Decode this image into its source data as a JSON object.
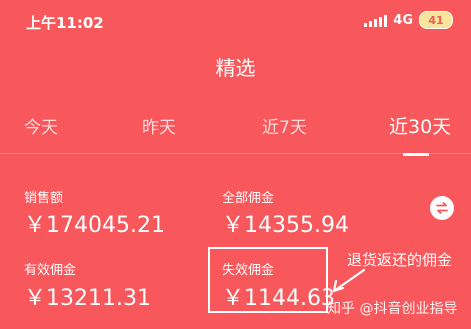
{
  "status_bar": {
    "time": "上午11:02",
    "network": "4G",
    "battery": "41"
  },
  "header": {
    "title": "精选"
  },
  "tabs": [
    {
      "label": "今天"
    },
    {
      "label": "昨天"
    },
    {
      "label": "近7天"
    },
    {
      "label": "近30天"
    }
  ],
  "active_tab": "近30天",
  "metrics": {
    "sales": {
      "label": "销售额",
      "value": "￥174045.21"
    },
    "total_commission": {
      "label": "全部佣金",
      "value": "￥14355.94"
    },
    "valid_commission": {
      "label": "有效佣金",
      "value": "￥13211.31"
    },
    "invalid_commission": {
      "label": "失效佣金",
      "value": "￥1144.63"
    }
  },
  "annotation": {
    "text": "退货返还的佣金"
  },
  "watermark": {
    "text": "知乎 @抖音创业指导"
  },
  "icons": {
    "swap": "swap-icon",
    "signal": "signal-icon",
    "battery": "battery-icon",
    "arrow": "arrow-icon"
  },
  "colors": {
    "background": "#f8575b",
    "text": "#ffffff",
    "battery_fill": "#f7e59b"
  }
}
